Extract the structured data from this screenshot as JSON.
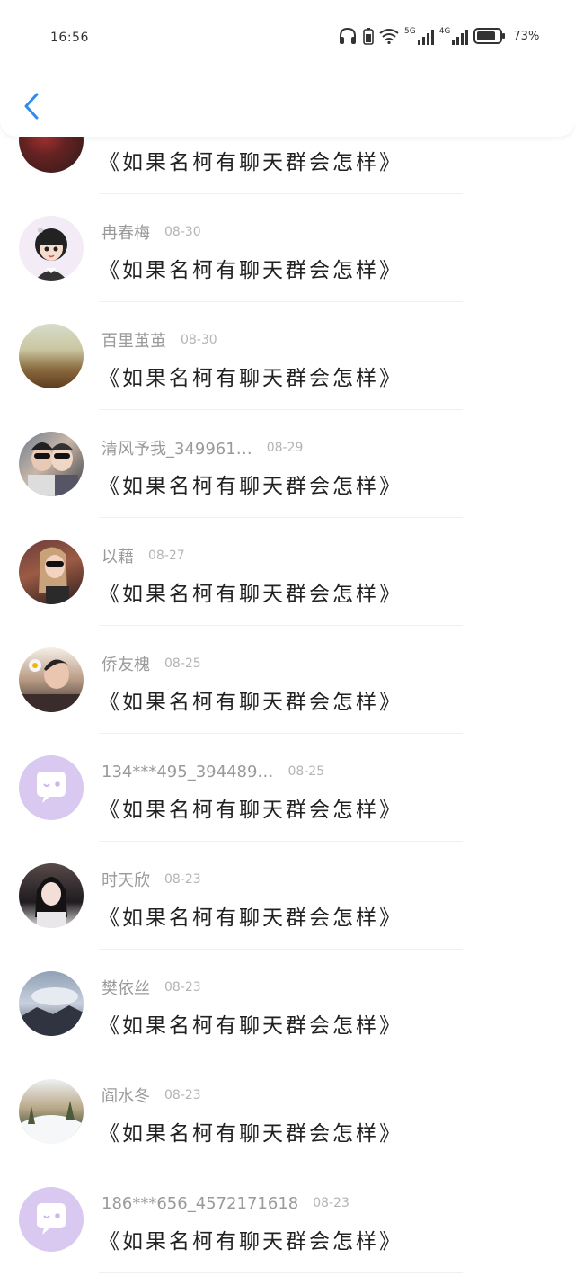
{
  "status_bar": {
    "time": "16:56",
    "battery": "73%",
    "network_5g": "5G",
    "network_4g": "4G"
  },
  "header": {
    "back_icon": "chevron-left-icon",
    "accent_color": "#2d8cf0"
  },
  "messages": [
    {
      "name": "",
      "date": "",
      "text": "《如果名柯有聊天群会怎样》",
      "avatar": "photo"
    },
    {
      "name": "冉春梅",
      "date": "08-30",
      "text": "《如果名柯有聊天群会怎样》",
      "avatar": "photo"
    },
    {
      "name": "百里茧茧",
      "date": "08-30",
      "text": "《如果名柯有聊天群会怎样》",
      "avatar": "photo"
    },
    {
      "name": "清风予我_349961…",
      "date": "08-29",
      "text": "《如果名柯有聊天群会怎样》",
      "avatar": "photo"
    },
    {
      "name": "以藉",
      "date": "08-27",
      "text": "《如果名柯有聊天群会怎样》",
      "avatar": "photo"
    },
    {
      "name": "侨友槐",
      "date": "08-25",
      "text": "《如果名柯有聊天群会怎样》",
      "avatar": "photo"
    },
    {
      "name": "134***495_394489…",
      "date": "08-25",
      "text": "《如果名柯有聊天群会怎样》",
      "avatar": "default-chat-icon"
    },
    {
      "name": "时天欣",
      "date": "08-23",
      "text": "《如果名柯有聊天群会怎样》",
      "avatar": "photo"
    },
    {
      "name": "樊依丝",
      "date": "08-23",
      "text": "《如果名柯有聊天群会怎样》",
      "avatar": "photo"
    },
    {
      "name": "阎水冬",
      "date": "08-23",
      "text": "《如果名柯有聊天群会怎样》",
      "avatar": "photo"
    },
    {
      "name": "186***656_4572171618",
      "date": "08-23",
      "text": "《如果名柯有聊天群会怎样》",
      "avatar": "default-chat-icon"
    }
  ]
}
